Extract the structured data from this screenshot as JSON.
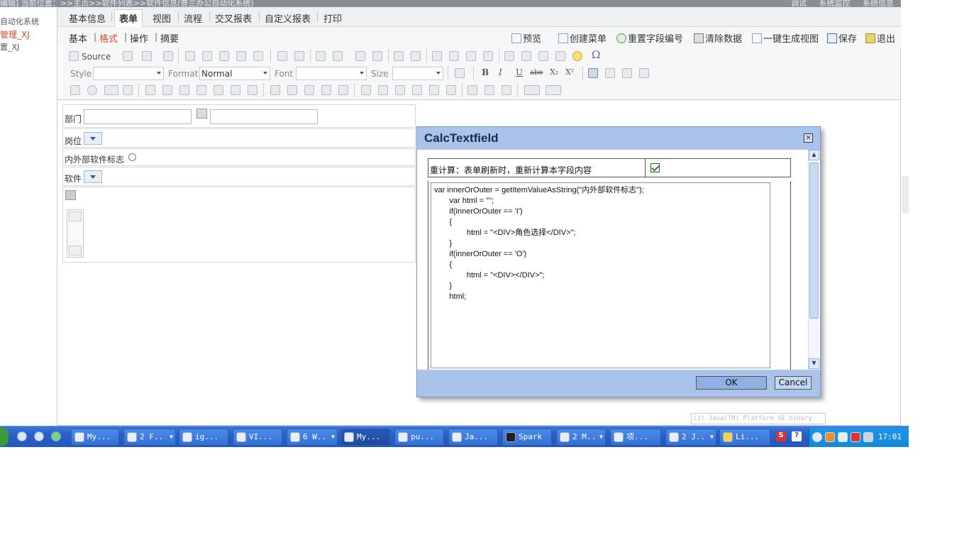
{
  "topbar": {
    "breadcrumb": "编辑]    当前位置：>>主页>>软件列表>>软件信息(普兰办公自动化系统)",
    "right_items": [
      "调试",
      "系统监控",
      "系统信息"
    ]
  },
  "leftnav": {
    "item1": "自动化系统",
    "item2": "管理_XJ",
    "item3": "置_XJ"
  },
  "tabs": [
    "基本信息",
    "表单",
    "视图",
    "流程",
    "交叉报表",
    "自定义报表",
    "打印"
  ],
  "active_tab": "表单",
  "subtabs": [
    "基本",
    "格式",
    "操作",
    "摘要"
  ],
  "active_subtab": "格式",
  "actions": [
    "预览",
    "创建菜单",
    "重置字段编号",
    "清除数据",
    "一键生成视图",
    "保存",
    "退出"
  ],
  "toolbar": {
    "source_label": "Source",
    "style_label": "Style",
    "format_label": "Format",
    "format_value": "Normal",
    "font_label": "Font",
    "size_label": "Size",
    "omega": "Ω",
    "bold": "B",
    "italic": "I",
    "underline": "U",
    "strike": "abe",
    "sub": "X₂",
    "sup": "X²"
  },
  "form": {
    "dept_label": "部门",
    "post_label": "岗位",
    "flag_label": "内外部软件标志",
    "software_label": "软件"
  },
  "dialog": {
    "title": "CalcTextfield",
    "close": "×",
    "recalc_label": "重计算：表单刷新时，重新计算本字段内容",
    "recalc_checked": true,
    "code_lines": [
      "var innerOrOuter = getItemValueAsString(\"内外部软件标志\");",
      "       var html = \"\";",
      "       if(innerOrOuter == 'I')",
      "       {",
      "               html = \"<DIV>角色选择</DIV>\";",
      "       }",
      "       if(innerOrOuter == 'O')",
      "       {",
      "               html = \"<DIV></DIV>\";",
      "       }",
      "       html;"
    ],
    "ok_label": "OK",
    "cancel_label": "Cancel"
  },
  "tooltip": "(2) Java(TM) Platform SE binary",
  "taskbar": {
    "buttons": [
      "My...",
      "2 F..",
      "ig...",
      "VI...",
      "6 W..",
      "My...",
      "pu...",
      "Ja...",
      "Spark",
      "2 M..",
      "项...",
      "2 J..",
      "Li..."
    ],
    "clock": "17:01"
  },
  "colors": {
    "accent_red": "#d64b2a",
    "dialog_blue": "#a9c3ea",
    "taskbar_blue": "#2a5fc4"
  }
}
